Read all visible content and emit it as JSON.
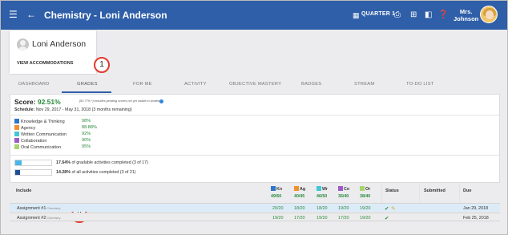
{
  "header": {
    "title": "Chemistry - Loni Anderson",
    "quarter_label": "QUARTER 1",
    "user_line1": "Mrs.",
    "user_line2": "Johnson",
    "icons": [
      "hamburger-icon",
      "back-arrow-icon",
      "calendar-icon",
      "print-icon",
      "add-icon",
      "clipboard-icon",
      "help-icon"
    ]
  },
  "student": {
    "name": "Loni Anderson",
    "accommodations_link": "VIEW ACCOMMODATIONS"
  },
  "callouts": [
    "1",
    "2"
  ],
  "tabs": [
    {
      "label": "DASHBOARD"
    },
    {
      "label": "GRADES",
      "active": true
    },
    {
      "label": "FOR ME"
    },
    {
      "label": "ACTIVITY"
    },
    {
      "label": "OBJECTIVE MASTERY"
    },
    {
      "label": "BADGES"
    },
    {
      "label": "STREAM"
    },
    {
      "label": "TO-DO LIST"
    }
  ],
  "score": {
    "label": "Score:",
    "value": "92.51%",
    "note": "[93.77% *] includes pending scores not yet visible to student",
    "schedule_label": "Schedule:",
    "schedule_text": "Nov 29, 2017 - May 31, 2018 (3 months remaining)"
  },
  "categories": [
    {
      "name": "Knowledge & Thinking",
      "value": "98%",
      "color": "#2f75c9"
    },
    {
      "name": "Agency",
      "value": "88.88%",
      "color": "#f0922b"
    },
    {
      "name": "Written Communication",
      "value": "92%",
      "color": "#45c6d4"
    },
    {
      "name": "Collaboration",
      "value": "90%",
      "color": "#9c5bc9"
    },
    {
      "name": "Oral Communication",
      "value": "95%",
      "color": "#a7d46c"
    }
  ],
  "progress": [
    {
      "pct": "17.64%",
      "text": "of gradable activities completed (3 of 17)",
      "fraction": 0.1764,
      "color": "#48b6e8"
    },
    {
      "pct": "14.28%",
      "text": "of all activities completed (3 of 21)",
      "fraction": 0.1428,
      "color": "#1e4f97"
    }
  ],
  "table": {
    "col_include": "Include",
    "col_status": "Status",
    "col_submitted": "Submitted",
    "col_due": "Due",
    "cat_headers": [
      {
        "abbr": "Kn",
        "score": "49/50",
        "color": "#2f75c9"
      },
      {
        "abbr": "Ag",
        "score": "40/45",
        "color": "#f0922b"
      },
      {
        "abbr": "Wr",
        "score": "46/50",
        "color": "#45c6d4"
      },
      {
        "abbr": "Co",
        "score": "36/40",
        "color": "#9c5bc9"
      },
      {
        "abbr": "Or",
        "score": "38/40",
        "color": "#a7d46c"
      }
    ],
    "rows": [
      {
        "name": "Assignment #1",
        "tag": "Chemistry",
        "scores": [
          "20/20",
          "18/20",
          "18/20",
          "19/20",
          "19/20"
        ],
        "due": "Jan 29, 2018",
        "edit": true
      },
      {
        "name": "Assignment #2",
        "tag": "Chemistry",
        "scores": [
          "19/20",
          "17/20",
          "19/20",
          "17/20",
          "19/20"
        ],
        "due": "Feb 25, 2018",
        "edit": false
      }
    ]
  }
}
